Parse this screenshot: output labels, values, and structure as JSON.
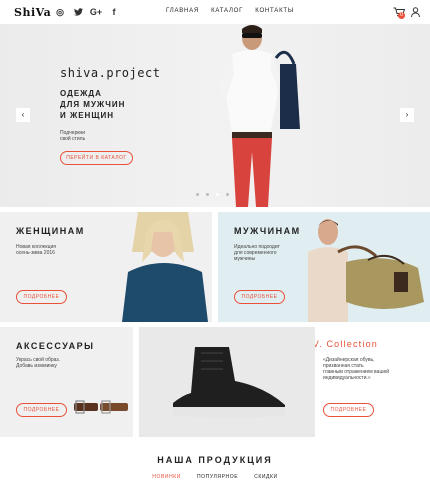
{
  "header": {
    "logo": "ShiVa",
    "social": [
      {
        "icon": "instagram-icon",
        "glyph": "◎"
      },
      {
        "icon": "twitter-icon",
        "glyph": "🐦"
      },
      {
        "icon": "google-plus-icon",
        "glyph": "G+"
      },
      {
        "icon": "facebook-icon",
        "glyph": "f"
      }
    ],
    "nav": [
      "ГЛАВНАЯ",
      "КАТАЛОГ",
      "КОНТАКТЫ"
    ],
    "cart_count": "0"
  },
  "hero": {
    "brand": "shiva.project",
    "title_line1": "ОДЕЖДА",
    "title_line2": "ДЛЯ МУЖЧИН",
    "title_line3": "И ЖЕНЩИН",
    "subtitle_line1": "Подчеркни",
    "subtitle_line2": "свой стиль",
    "button": "ПЕРЕЙТИ В КАТАЛОГ",
    "prev_glyph": "‹",
    "next_glyph": "›"
  },
  "categories": {
    "women": {
      "title": "ЖЕНЩИНАМ",
      "text_line1": "Новая коллекция",
      "text_line2": "осень-зима 2016",
      "button": "ПОДРОБНЕЕ"
    },
    "men": {
      "title": "МУЖЧИНАМ",
      "text_line1": "Идеально подходит",
      "text_line2": "для современного",
      "text_line3": "мужчины",
      "button": "ПОДРОБНЕЕ"
    },
    "accessories": {
      "title": "АКСЕССУАРЫ",
      "text_line1": "Укрась свой образ.",
      "text_line2": "Добавь изюминку",
      "button": "ПОДРОБНЕЕ"
    },
    "fedorov": {
      "title": "FEDOROV. Collection",
      "text_line1": "«Дизайнерская обувь,",
      "text_line2": "призванная стать",
      "text_line3": "главным отражением вашей",
      "text_line4": "индивидуальности.»",
      "button": "ПОДРОБНЕЕ"
    }
  },
  "products": {
    "title": "НАША ПРОДУКЦИЯ",
    "tabs": [
      "НОВИНКИ",
      "ПОПУЛЯРНОЕ",
      "СКИДКИ"
    ]
  },
  "colors": {
    "accent": "#e8523a",
    "men_bg": "#e1eef1"
  }
}
